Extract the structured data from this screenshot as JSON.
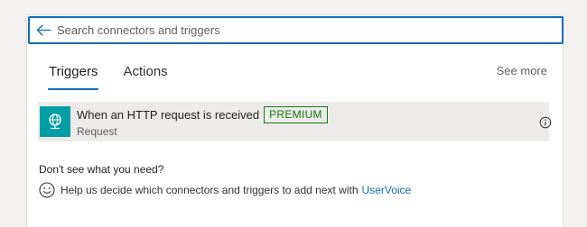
{
  "search": {
    "placeholder": "Search connectors and triggers",
    "value": ""
  },
  "tabs": [
    {
      "label": "Triggers",
      "active": true
    },
    {
      "label": "Actions",
      "active": false
    }
  ],
  "see_more_label": "See more",
  "triggers": [
    {
      "title": "When an HTTP request is received",
      "badge": "PREMIUM",
      "subtitle": "Request",
      "icon": "globe-icon",
      "icon_color": "#009da5"
    }
  ],
  "help": {
    "heading": "Don't see what you need?",
    "text": "Help us decide which connectors and triggers to add next with",
    "link_label": "UserVoice"
  },
  "colors": {
    "accent": "#0f6cbd",
    "premium": "#107c10",
    "connector": "#009da5"
  }
}
